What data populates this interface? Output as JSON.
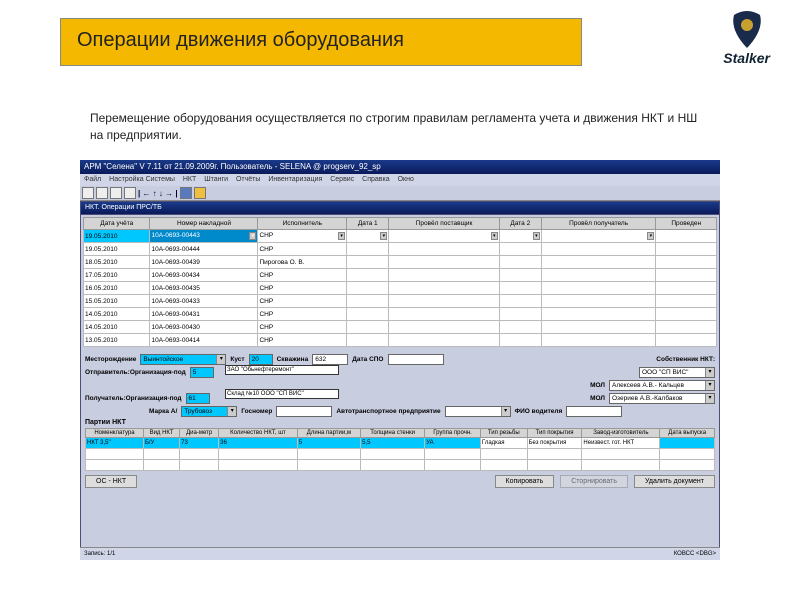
{
  "slide": {
    "title": "Операции движения оборудования",
    "logo_text": "Stalker",
    "intro": "Перемещение оборудования осуществляется по строгим правилам регламента учета и движения НКТ и НШ на предприятии."
  },
  "app": {
    "title": "АРМ \"Селена\" V 7.11  от 21.09.2009г.  Пользователь - SELENA @ progserv_92_sp",
    "menu": [
      "Файл",
      "Настройка Системы",
      "НКТ",
      "Штанги",
      "Отчёты",
      "Инвентаризация",
      "Сервис",
      "Справка",
      "Окно"
    ],
    "child_title": "НКТ. Операции ПРС/ТБ",
    "grid": {
      "headers": [
        "Дата учёта",
        "Номер накладной",
        "Исполнитель",
        "Дата 1",
        "Провёл поставщик",
        "Дата 2",
        "Провёл получатель",
        "Проведен"
      ],
      "rows": [
        {
          "d": "19.05.2010",
          "n": "10А-0693-00443",
          "e": "СНР",
          "sel": true
        },
        {
          "d": "19.05.2010",
          "n": "10А-0693-00444",
          "e": "СНР"
        },
        {
          "d": "18.05.2010",
          "n": "10А-0693-00439",
          "e": "Пирогова О. В."
        },
        {
          "d": "17.05.2010",
          "n": "10А-0693-00434",
          "e": "СНР"
        },
        {
          "d": "16.05.2010",
          "n": "10А-0693-00435",
          "e": "СНР"
        },
        {
          "d": "15.05.2010",
          "n": "10А-0693-00433",
          "e": "СНР"
        },
        {
          "d": "14.05.2010",
          "n": "10А-0693-00431",
          "e": "СНР"
        },
        {
          "d": "14.05.2010",
          "n": "10А-0693-00430",
          "e": "СНР"
        },
        {
          "d": "13.05.2010",
          "n": "10А-0693-00414",
          "e": "СНР"
        }
      ]
    },
    "form": {
      "f1_lbl": "Месторождение",
      "f1": "Выинтойское",
      "f2_lbl": "Куст",
      "f2": "20",
      "f3_lbl": "Скважина",
      "f3": "632",
      "f4_lbl": "Дата СПО",
      "f5_lbl": "Собственник НКТ:",
      "f6_lbl": "Отправитель:Организация-под",
      "f6": "5",
      "pop1": "ЗАО \"Обьнефтеремонт\"",
      "f7_lbl": "",
      "f7_mol": "МОЛ",
      "f7": "Алексеев А.В.- Кальцев",
      "f8_lbl": "Получатель:Организация-под",
      "f8": "61",
      "pop2": "Склад №10 ООО \"СП ВИС\"",
      "f9_mol": "МОЛ",
      "f9": "Озериев А.В.-Калбаков",
      "f10_lbl": "Марка А/",
      "f10": "Трубовоз",
      "f11_lbl": "Госномер",
      "f12_lbl": "Автотранспортное предприятие",
      "f13_lbl": "ФИО водителя",
      "owner": "ООО \"СП ВИС\""
    },
    "parts": {
      "label": "Партии НКТ",
      "headers": [
        "Номенклатура",
        "Вид НКТ",
        "Диа-метр",
        "Количество НКТ, шт",
        "Длина партии,м",
        "Толщина стенки",
        "Группа прочн.",
        "Тип резьбы",
        "Тип покрытия",
        "Завод-изготовитель",
        "Дата выпуска"
      ],
      "row": {
        "nom": "НКТ 3,5''",
        "vid": "Б/У",
        "dia": "73",
        "qty": "36",
        "len": "5",
        "thk": "5,5",
        "grp": "УА",
        "res": "Гладкая",
        "cov": "Без покрытия",
        "zav": "Неизвест. гот. НКТ",
        "date": ""
      }
    },
    "buttons": {
      "left": "ОС - НКТ",
      "b1": "Копировать",
      "b2": "Сторнировать",
      "b3": "Удалить документ"
    },
    "status": {
      "left": "Запись: 1/1",
      "right": "КОВСС <DBG>"
    }
  }
}
